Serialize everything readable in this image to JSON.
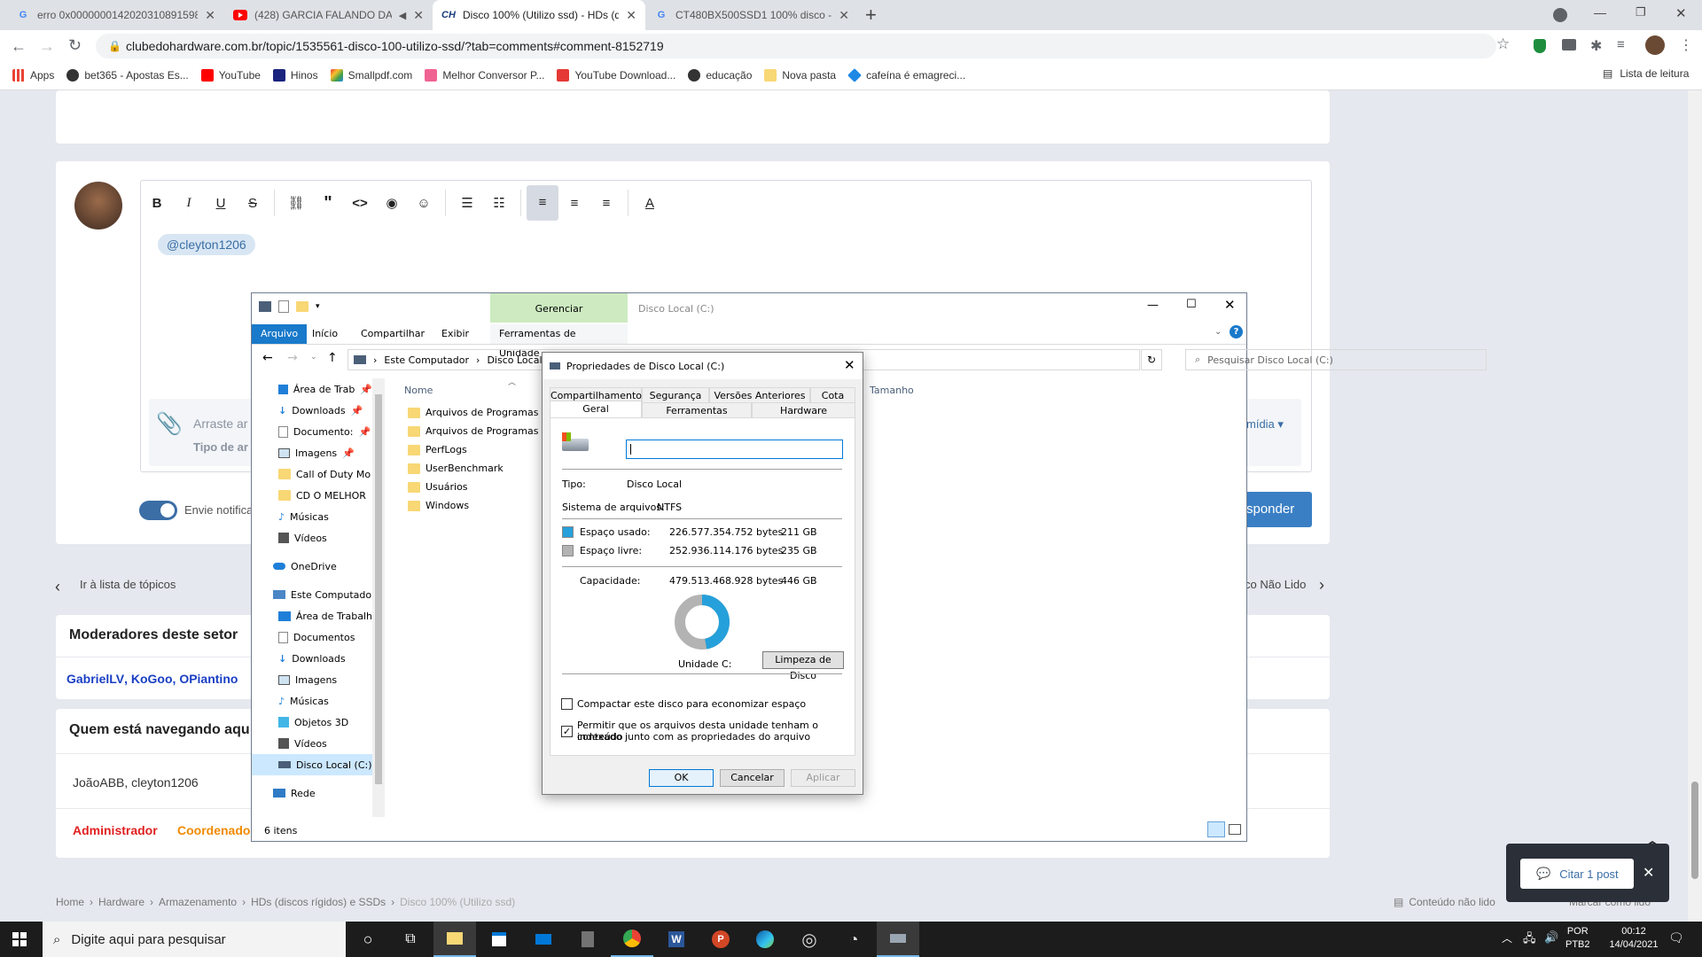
{
  "browser": {
    "tabs": [
      {
        "title": "erro 0x000000014202031089159​8...",
        "icon": "google-icon"
      },
      {
        "title": "(428) GARCIA FALANDO DA...",
        "icon": "youtube-icon"
      },
      {
        "title": "Disco 100% (Utilizo ssd) - HDs (d...",
        "icon": "clubedohardware-icon"
      },
      {
        "title": "CT480BX500SSD1 100% disco - Pe...",
        "icon": "google-icon"
      }
    ],
    "url": "clubedohardware.com.br/topic/1535561-disco-100-utilizo-ssd/?tab=comments#comment-8152719",
    "bookmarks": [
      {
        "label": "Apps",
        "color": "#ea4335"
      },
      {
        "label": "bet365 - Apostas Es...",
        "color": "#333333"
      },
      {
        "label": "YouTube",
        "color": "#ff0000"
      },
      {
        "label": "Hinos",
        "color": "#1a237e"
      },
      {
        "label": "Smallpdf.com",
        "color": "#e53935"
      },
      {
        "label": "Melhor Conversor P...",
        "color": "#f06292"
      },
      {
        "label": "YouTube Download...",
        "color": "#e53935"
      },
      {
        "label": "educação",
        "color": "#333333"
      },
      {
        "label": "Nova pasta",
        "color": "#f8d775"
      },
      {
        "label": "cafeína é emagreci...",
        "color": "#1e88e5"
      }
    ],
    "reading_list": "Lista de leitura"
  },
  "editor": {
    "mention": "@cleyton1206",
    "attach_text": "Arraste ar",
    "attach_sub": "Tipo de ar",
    "media_label": "mídia ▾",
    "notify_label": "Envie notificaç",
    "reply_button": "sponder"
  },
  "page": {
    "back_to_list": "Ir à lista de tópicos",
    "next_unread": "co Não Lido",
    "moderators_title": "Moderadores deste setor",
    "moderators": [
      "GabrielLV",
      "KoGoo",
      "OPiantino"
    ],
    "browsing_title": "Quem está navegando aqu",
    "browsing_users": "JoãoABB, cleyton1206",
    "roles": [
      "Administrador",
      "Coordenado"
    ],
    "breadcrumb": [
      "Home",
      "Hardware",
      "Armazenamento",
      "HDs (discos rígidos) e SSDs",
      "Disco 100% (Utilizo ssd)"
    ],
    "unread_content": "Conteúdo não lido",
    "mark_read": "Marcar como lido",
    "quote_button": "Citar 1 post"
  },
  "explorer": {
    "ribbon_context": "Gerenciar",
    "ribbon_context_tab": "Ferramentas de Unidade",
    "window_title": "Disco Local (C:)",
    "tabs": [
      "Arquivo",
      "Início",
      "Compartilhar",
      "Exibir"
    ],
    "address": [
      "Este Computador",
      "Disco Local ("
    ],
    "search_placeholder": "Pesquisar Disco Local (C:)",
    "col_name": "Nome",
    "col_size": "Tamanho",
    "nav_items": [
      {
        "label": "Área de Trab",
        "icon": "desktop-icon",
        "pinned": true
      },
      {
        "label": "Downloads",
        "icon": "download-icon",
        "pinned": true
      },
      {
        "label": "Documento:",
        "icon": "documents-icon",
        "pinned": true
      },
      {
        "label": "Imagens",
        "icon": "pictures-icon",
        "pinned": true
      },
      {
        "label": "Call of Duty  Mo",
        "icon": "folder-icon",
        "pinned": false
      },
      {
        "label": "CD O MELHOR",
        "icon": "folder-icon",
        "pinned": false
      },
      {
        "label": "Músicas",
        "icon": "music-icon",
        "pinned": false
      },
      {
        "label": "Vídeos",
        "icon": "videos-icon",
        "pinned": false
      }
    ],
    "onedrive": "OneDrive",
    "this_pc": "Este Computado",
    "pc_items": [
      {
        "label": "Área de Trabalh",
        "icon": "desktop-icon"
      },
      {
        "label": "Documentos",
        "icon": "documents-icon"
      },
      {
        "label": "Downloads",
        "icon": "download-icon"
      },
      {
        "label": "Imagens",
        "icon": "pictures-icon"
      },
      {
        "label": "Músicas",
        "icon": "music-icon"
      },
      {
        "label": "Objetos 3D",
        "icon": "3d-objects-icon"
      },
      {
        "label": "Vídeos",
        "icon": "videos-icon"
      },
      {
        "label": "Disco Local (C:)",
        "icon": "drive-icon"
      }
    ],
    "network": "Rede",
    "files": [
      "Arquivos de Programas",
      "Arquivos de Programas (x",
      "PerfLogs",
      "UserBenchmark",
      "Usuários",
      "Windows"
    ],
    "status": "6 itens"
  },
  "dialog": {
    "title": "Propriedades de Disco Local (C:)",
    "tabs_top": [
      "Compartilhamento",
      "Segurança",
      "Versões Anteriores",
      "Cota"
    ],
    "tabs_bottom": [
      "Geral",
      "Ferramentas",
      "Hardware"
    ],
    "name_value": "",
    "type_label": "Tipo:",
    "type_value": "Disco Local",
    "fs_label": "Sistema de arquivos:",
    "fs_value": "NTFS",
    "used_label": "Espaço usado:",
    "used_bytes": "226.577.354.752 bytes",
    "used_gb": "211 GB",
    "free_label": "Espaço livre:",
    "free_bytes": "252.936.114.176 bytes",
    "free_gb": "235 GB",
    "cap_label": "Capacidade:",
    "cap_bytes": "479.513.468.928 bytes",
    "cap_gb": "446 GB",
    "used_fraction": 0.4725,
    "used_color": "#26a0da",
    "free_color": "#b3b3b3",
    "drive_label": "Unidade C:",
    "cleanup_button": "Limpeza de Disco",
    "compress_label": "Compactar este disco para economizar espaço",
    "index_label_1": "Permitir que os arquivos desta unidade tenham o conteúdo",
    "index_label_2": "indexado junto com as propriedades do arquivo",
    "ok": "OK",
    "cancel": "Cancelar",
    "apply": "Aplicar"
  },
  "taskbar": {
    "search_placeholder": "Digite aqui para pesquisar",
    "lang_1": "POR",
    "lang_2": "PTB2",
    "time": "00:12",
    "date": "14/04/2021"
  }
}
